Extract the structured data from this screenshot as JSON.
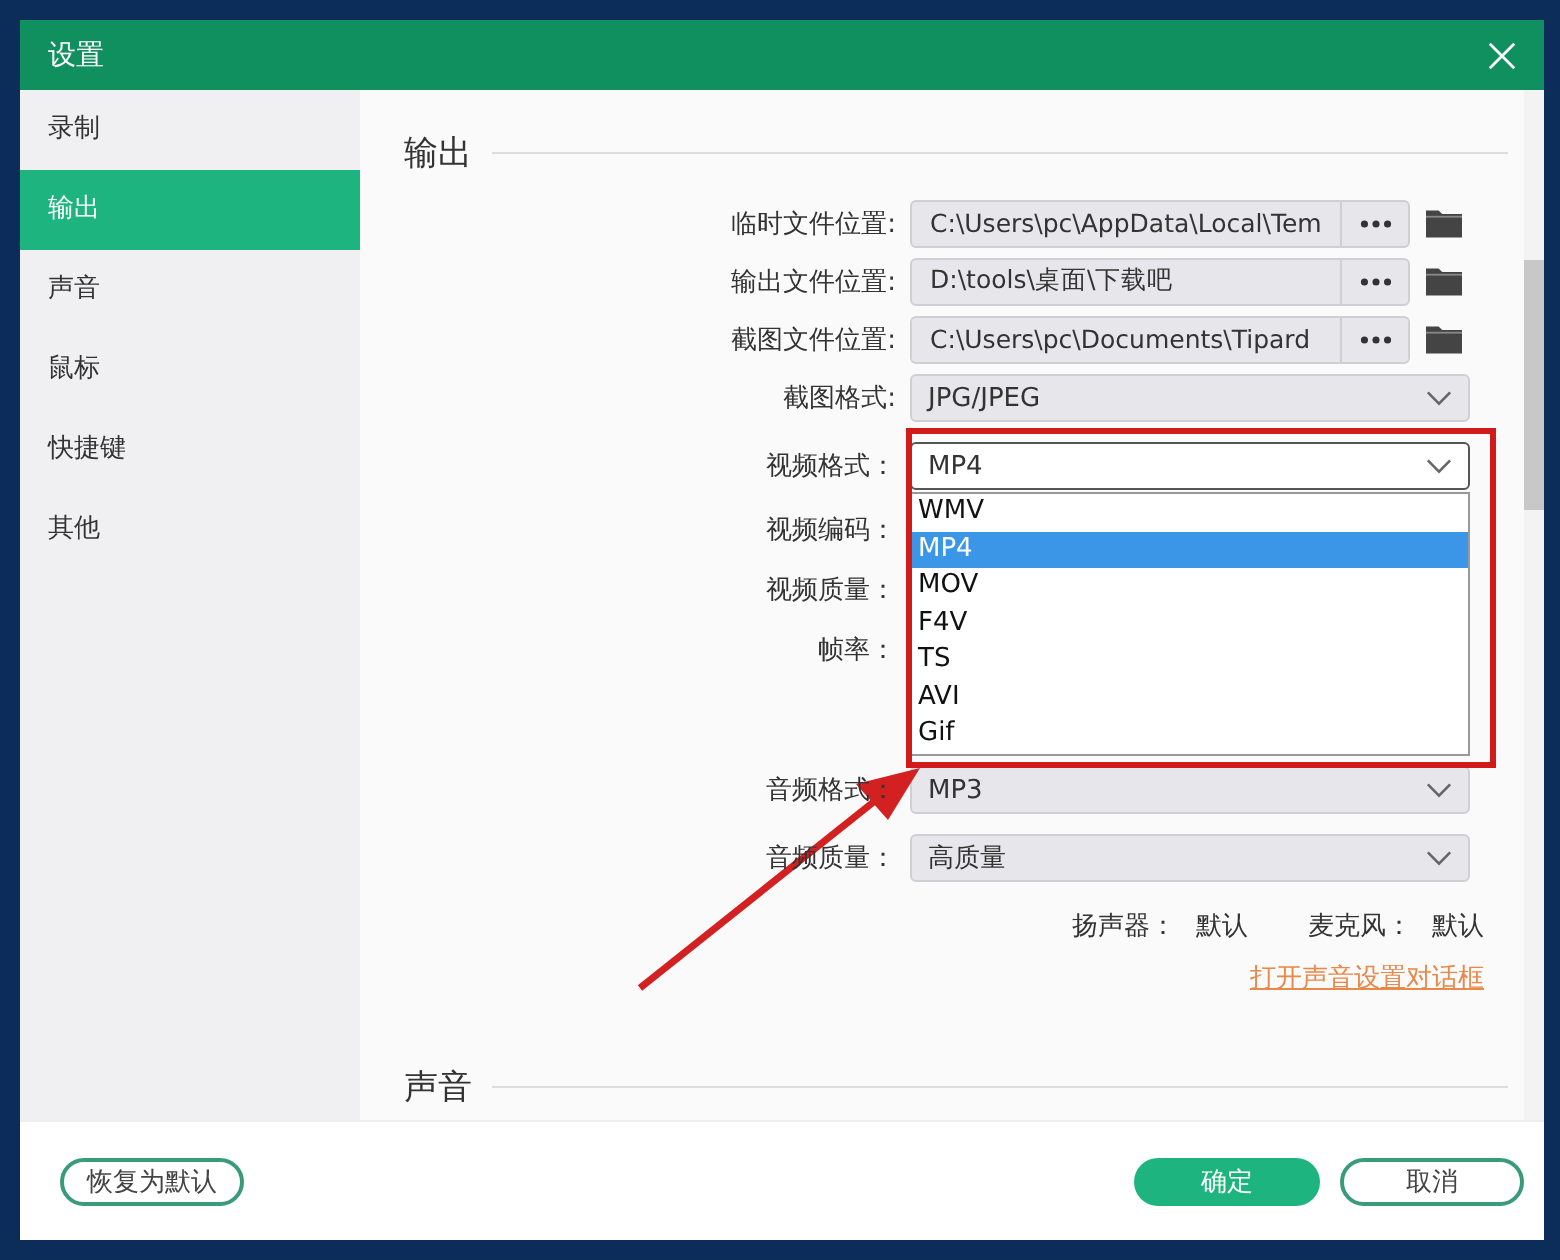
{
  "window": {
    "title": "设置"
  },
  "sidebar": {
    "items": [
      {
        "label": "录制",
        "selected": false
      },
      {
        "label": "输出",
        "selected": true
      },
      {
        "label": "声音",
        "selected": false
      },
      {
        "label": "鼠标",
        "selected": false
      },
      {
        "label": "快捷键",
        "selected": false
      },
      {
        "label": "其他",
        "selected": false
      }
    ]
  },
  "output_section": {
    "title": "输出",
    "rows": [
      {
        "kind": "path",
        "label": "临时文件位置:",
        "value": "C:\\Users\\pc\\AppData\\Local\\Tem"
      },
      {
        "kind": "path",
        "label": "输出文件位置:",
        "value": "D:\\tools\\桌面\\下载吧"
      },
      {
        "kind": "path",
        "label": "截图文件位置:",
        "value": "C:\\Users\\pc\\Documents\\Tipard"
      },
      {
        "kind": "select",
        "label": "截图格式:",
        "value": "JPG/JPEG"
      },
      {
        "kind": "select",
        "label": "视频格式：",
        "value": "MP4",
        "expanded": true,
        "options": [
          {
            "label": "WMV",
            "selected": false
          },
          {
            "label": "MP4",
            "selected": true
          },
          {
            "label": "MOV",
            "selected": false
          },
          {
            "label": "F4V",
            "selected": false
          },
          {
            "label": "TS",
            "selected": false
          },
          {
            "label": "AVI",
            "selected": false
          },
          {
            "label": "Gif",
            "selected": false
          }
        ]
      },
      {
        "kind": "covered",
        "label": "视频编码："
      },
      {
        "kind": "covered",
        "label": "视频质量："
      },
      {
        "kind": "covered",
        "label": "帧率："
      },
      {
        "kind": "select",
        "label": "音频格式：",
        "value": "MP3"
      },
      {
        "kind": "select",
        "label": "音频质量：",
        "value": "高质量"
      }
    ],
    "devices": [
      {
        "label": "扬声器：",
        "value": "默认"
      },
      {
        "label": "麦克风：",
        "value": "默认"
      }
    ],
    "link": "打开声音设置对话框"
  },
  "sound_section": {
    "title": "声音"
  },
  "footer": {
    "reset_button": "恢复为默认",
    "ok_button": "确定",
    "cancel_button": "取消"
  }
}
